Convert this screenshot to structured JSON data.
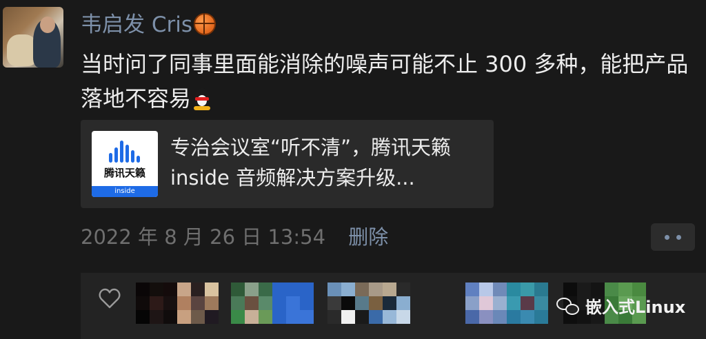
{
  "post": {
    "username": "韦启发 Cris",
    "text_line": "当时问了同事里面能消除的噪声可能不止 300 多种，能把产品落地不容易",
    "emoji_after_name": "basketball-icon",
    "emoji_after_text": "qq-penguin-icon"
  },
  "link_card": {
    "title": "专治会议室“听不清”，腾讯天籁 inside 音频解决方案升级...",
    "thumb_name": "腾讯天籁",
    "thumb_footer": "inside"
  },
  "meta": {
    "timestamp": "2022 年 8 月 26 日 13:54",
    "delete_label": "删除"
  },
  "likes": {
    "watermark": "嵌入式Linux"
  },
  "colors": {
    "background": "#191919",
    "link_blue": "#7d90a9",
    "card": "#2a2a2a",
    "brand_blue": "#1e6be6"
  }
}
